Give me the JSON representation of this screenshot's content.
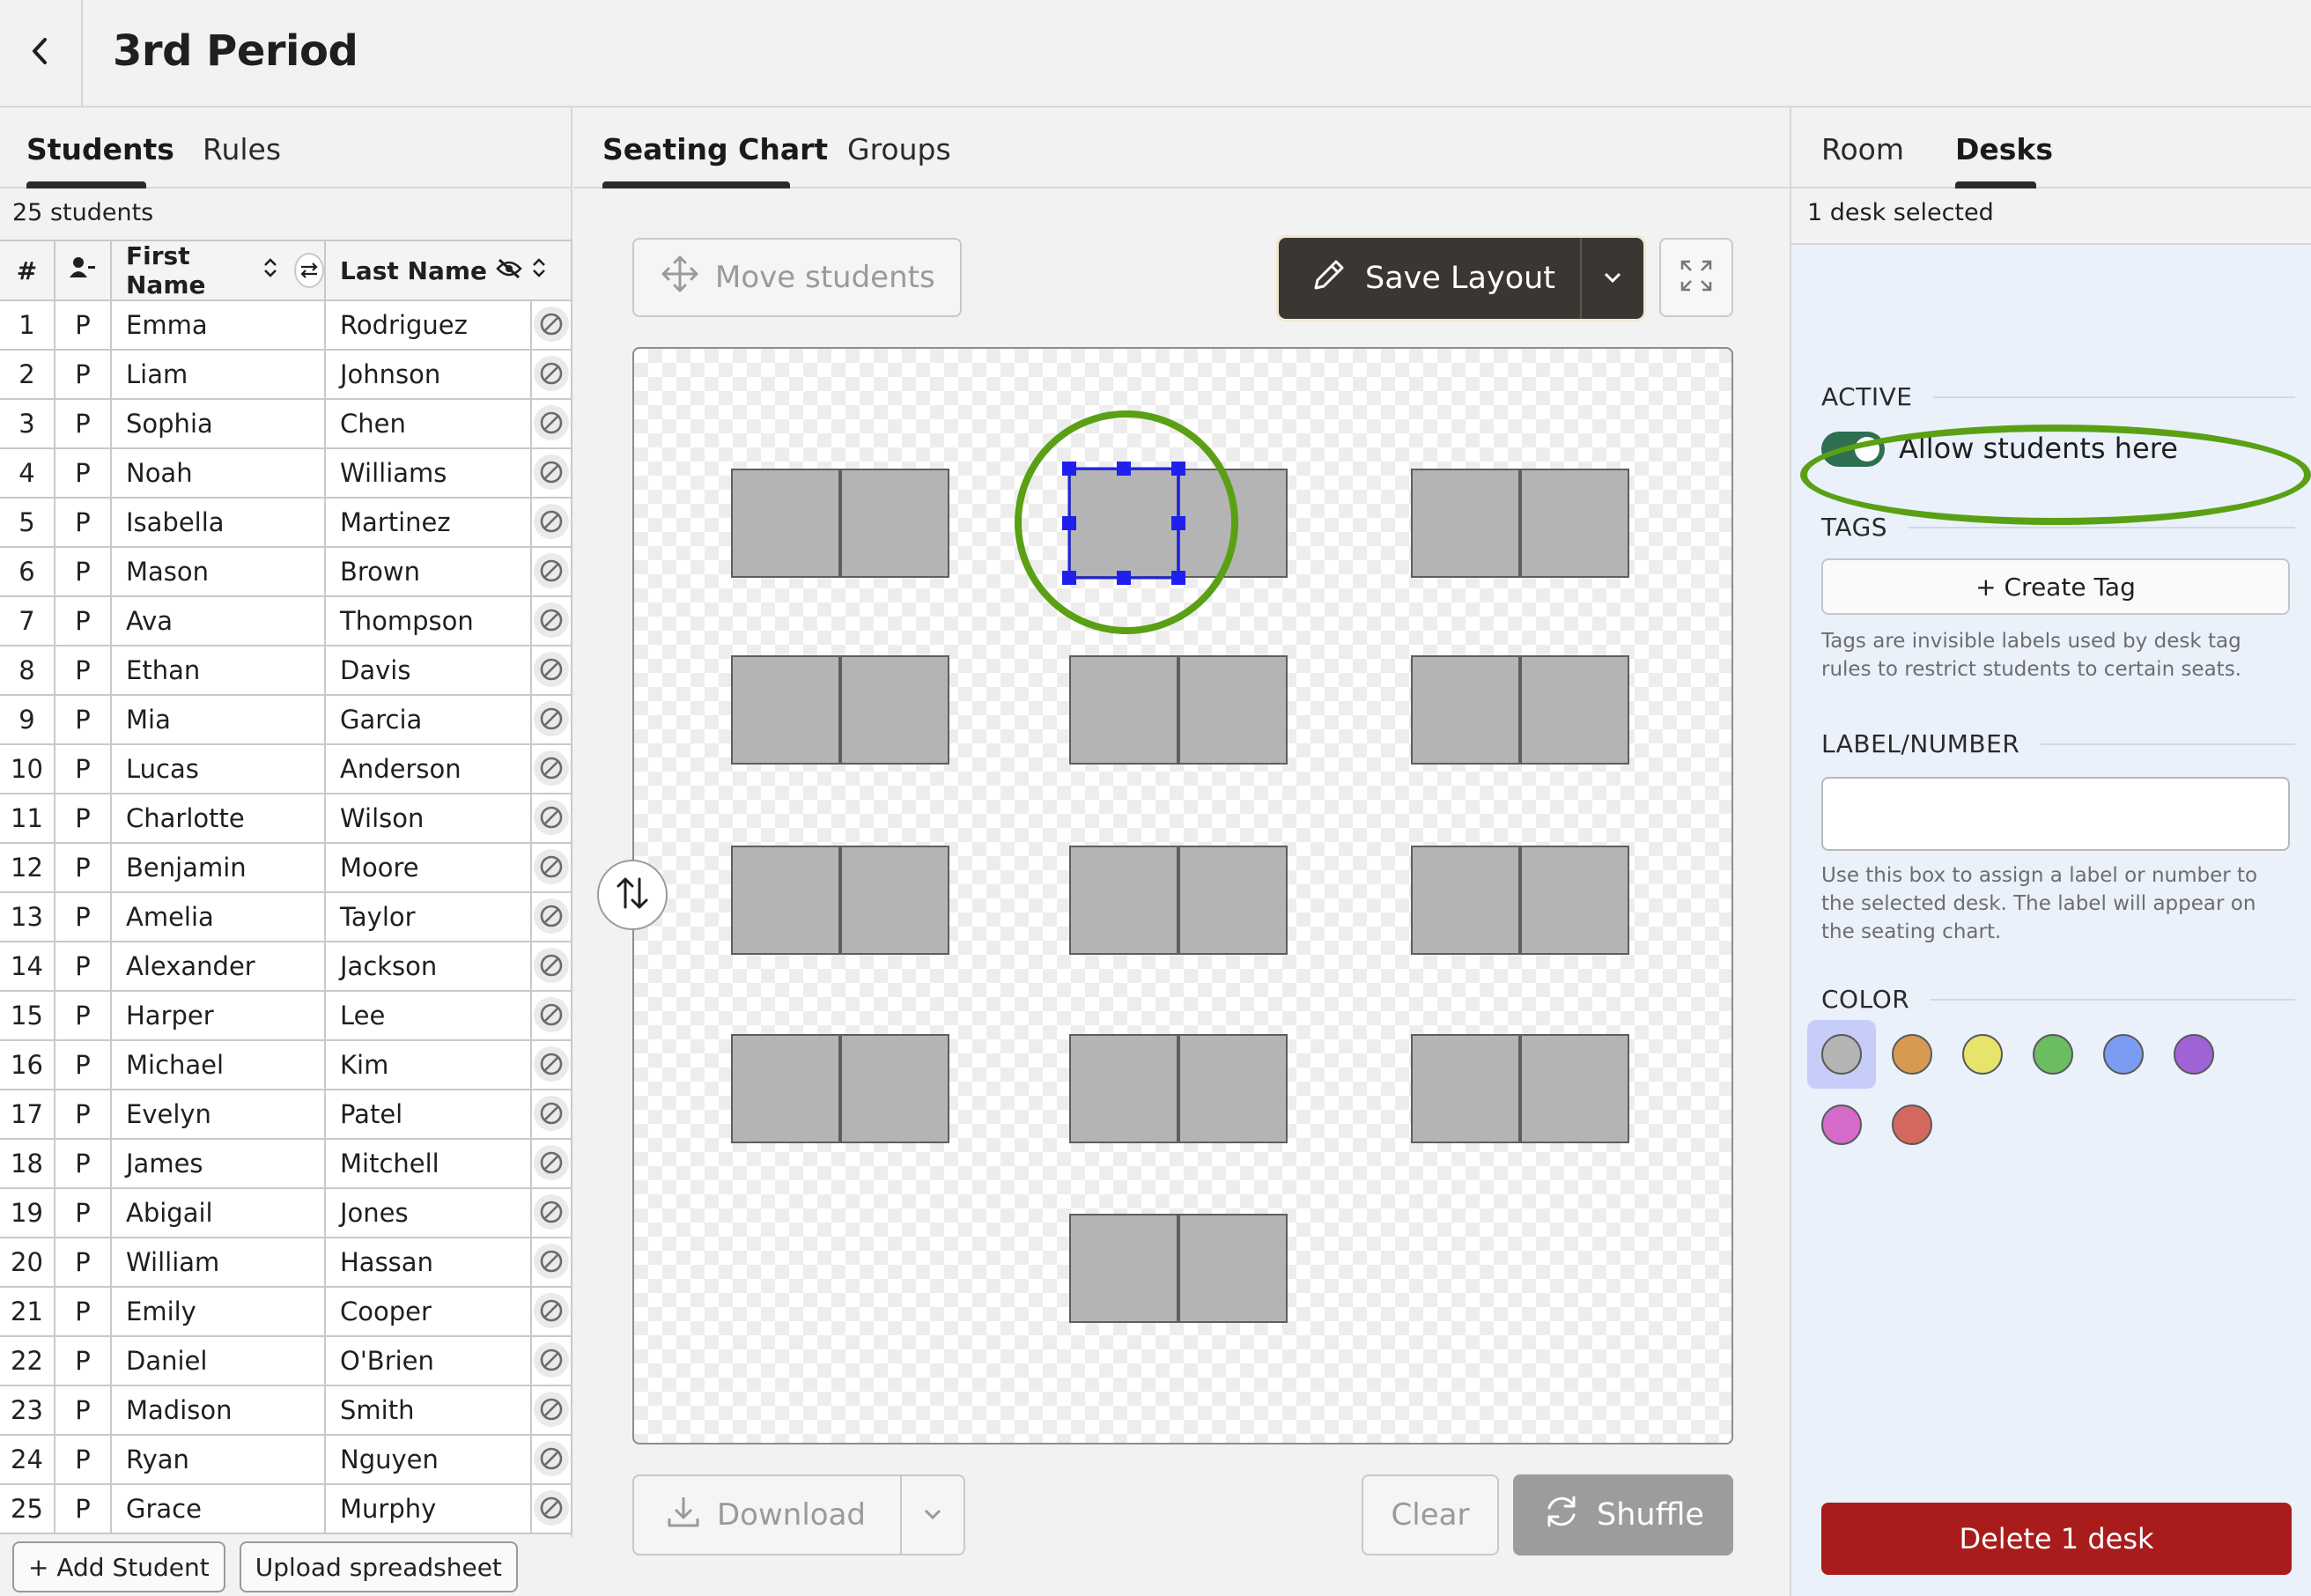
{
  "header": {
    "title": "3rd Period",
    "back_icon": "chevron-left-icon"
  },
  "left": {
    "tabs": [
      {
        "label": "Students",
        "active": true
      },
      {
        "label": "Rules",
        "active": false
      }
    ],
    "student_count": "25 students",
    "columns": {
      "num": "#",
      "first": "First Name",
      "last": "Last Name"
    },
    "students": [
      {
        "n": "1",
        "p": "P",
        "first": "Emma",
        "last": "Rodriguez"
      },
      {
        "n": "2",
        "p": "P",
        "first": "Liam",
        "last": "Johnson"
      },
      {
        "n": "3",
        "p": "P",
        "first": "Sophia",
        "last": "Chen"
      },
      {
        "n": "4",
        "p": "P",
        "first": "Noah",
        "last": "Williams"
      },
      {
        "n": "5",
        "p": "P",
        "first": "Isabella",
        "last": "Martinez"
      },
      {
        "n": "6",
        "p": "P",
        "first": "Mason",
        "last": "Brown"
      },
      {
        "n": "7",
        "p": "P",
        "first": "Ava",
        "last": "Thompson"
      },
      {
        "n": "8",
        "p": "P",
        "first": "Ethan",
        "last": "Davis"
      },
      {
        "n": "9",
        "p": "P",
        "first": "Mia",
        "last": "Garcia"
      },
      {
        "n": "10",
        "p": "P",
        "first": "Lucas",
        "last": "Anderson"
      },
      {
        "n": "11",
        "p": "P",
        "first": "Charlotte",
        "last": "Wilson"
      },
      {
        "n": "12",
        "p": "P",
        "first": "Benjamin",
        "last": "Moore"
      },
      {
        "n": "13",
        "p": "P",
        "first": "Amelia",
        "last": "Taylor"
      },
      {
        "n": "14",
        "p": "P",
        "first": "Alexander",
        "last": "Jackson"
      },
      {
        "n": "15",
        "p": "P",
        "first": "Harper",
        "last": "Lee"
      },
      {
        "n": "16",
        "p": "P",
        "first": "Michael",
        "last": "Kim"
      },
      {
        "n": "17",
        "p": "P",
        "first": "Evelyn",
        "last": "Patel"
      },
      {
        "n": "18",
        "p": "P",
        "first": "James",
        "last": "Mitchell"
      },
      {
        "n": "19",
        "p": "P",
        "first": "Abigail",
        "last": "Jones"
      },
      {
        "n": "20",
        "p": "P",
        "first": "William",
        "last": "Hassan"
      },
      {
        "n": "21",
        "p": "P",
        "first": "Emily",
        "last": "Cooper"
      },
      {
        "n": "22",
        "p": "P",
        "first": "Daniel",
        "last": "O'Brien"
      },
      {
        "n": "23",
        "p": "P",
        "first": "Madison",
        "last": "Smith"
      },
      {
        "n": "24",
        "p": "P",
        "first": "Ryan",
        "last": "Nguyen"
      },
      {
        "n": "25",
        "p": "P",
        "first": "Grace",
        "last": "Murphy"
      }
    ],
    "add_student": "+ Add Student",
    "upload": "Upload spreadsheet"
  },
  "center": {
    "tabs": [
      {
        "label": "Seating Chart",
        "active": true
      },
      {
        "label": "Groups",
        "active": false
      }
    ],
    "move_students": "Move students",
    "save_layout": "Save Layout",
    "download": "Download",
    "clear": "Clear",
    "shuffle": "Shuffle",
    "desk_color": "#b4b4b4",
    "selection_color": "#2020ee"
  },
  "right": {
    "tabs": [
      {
        "label": "Room",
        "active": false
      },
      {
        "label": "Desks",
        "active": true
      }
    ],
    "selected_count": "1 desk selected",
    "active_heading": "ACTIVE",
    "allow_label": "Allow students here",
    "allow_on": true,
    "tags_heading": "TAGS",
    "create_tag": "+ Create Tag",
    "tags_help": "Tags are invisible labels used by desk tag rules to restrict students to certain seats.",
    "label_heading": "LABEL/NUMBER",
    "label_value": "",
    "label_help": "Use this box to assign a label or number to the selected desk. The label will appear on the seating chart.",
    "color_heading": "COLOR",
    "colors": [
      "#b4b4b4",
      "#d89a52",
      "#e6e46a",
      "#6cbc62",
      "#7b9cf2",
      "#9f63d6",
      "#d56bc8",
      "#d4685f"
    ],
    "selected_color": "#b4b4b4",
    "delete": "Delete 1 desk",
    "delete_color": "#a91c1c"
  },
  "annotation_color": "#5aa014"
}
